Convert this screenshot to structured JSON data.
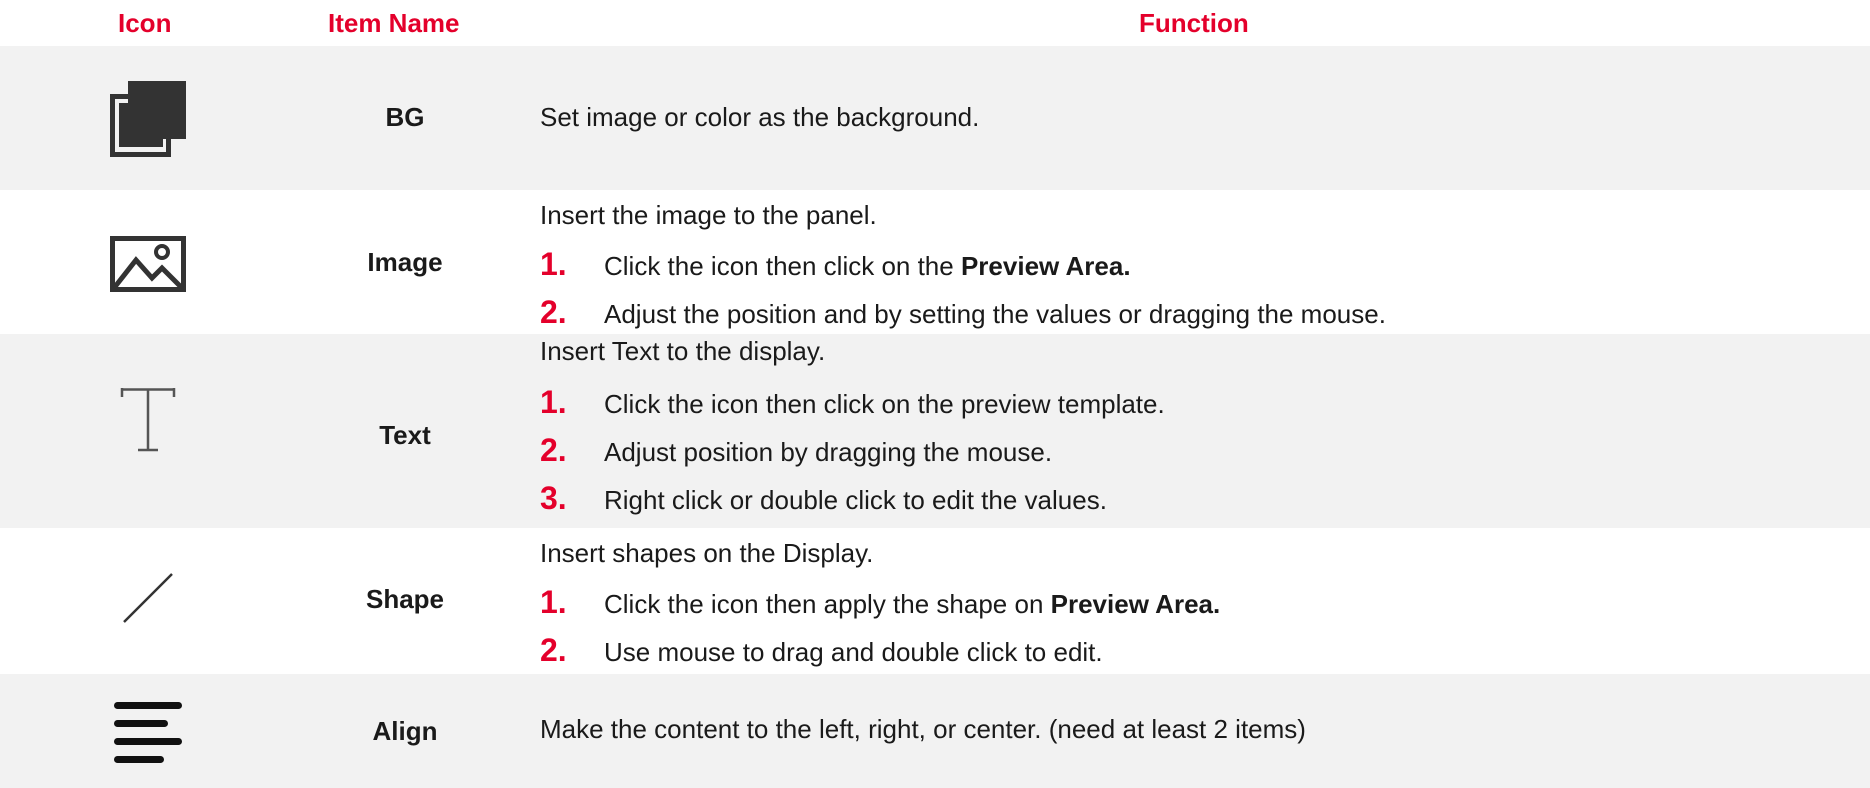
{
  "headers": {
    "icon": "Icon",
    "item_name": "Item Name",
    "function": "Function"
  },
  "rows": [
    {
      "name": "BG",
      "icon": "layers-icon",
      "description": "Set image or color as the background."
    },
    {
      "name": "Image",
      "icon": "image-icon",
      "description": "Insert the image to the panel.",
      "steps": [
        {
          "num": "1.",
          "text": "Click the icon then click on the ",
          "bold": "Preview Area."
        },
        {
          "num": "2.",
          "text": "Adjust the position and by setting the values or dragging the mouse."
        }
      ]
    },
    {
      "name": "Text",
      "icon": "text-icon",
      "description": "Insert Text to the display.",
      "steps": [
        {
          "num": "1.",
          "text": "Click the icon then click on the preview template."
        },
        {
          "num": "2.",
          "text": "Adjust position by dragging the mouse."
        },
        {
          "num": "3.",
          "text": "Right click or double click to edit the values."
        }
      ]
    },
    {
      "name": "Shape",
      "icon": "line-shape-icon",
      "description": "Insert shapes on the Display.",
      "steps": [
        {
          "num": "1.",
          "text": "Click the icon then apply the shape on ",
          "bold": "Preview Area."
        },
        {
          "num": "2.",
          "text": "Use mouse to drag and double click to edit."
        }
      ]
    },
    {
      "name": "Align",
      "icon": "align-left-icon",
      "description": "Make the content to the left, right, or center. (need at least 2 items)"
    }
  ],
  "colors": {
    "accent": "#e4002b",
    "row_shade": "#f2f2f2"
  }
}
